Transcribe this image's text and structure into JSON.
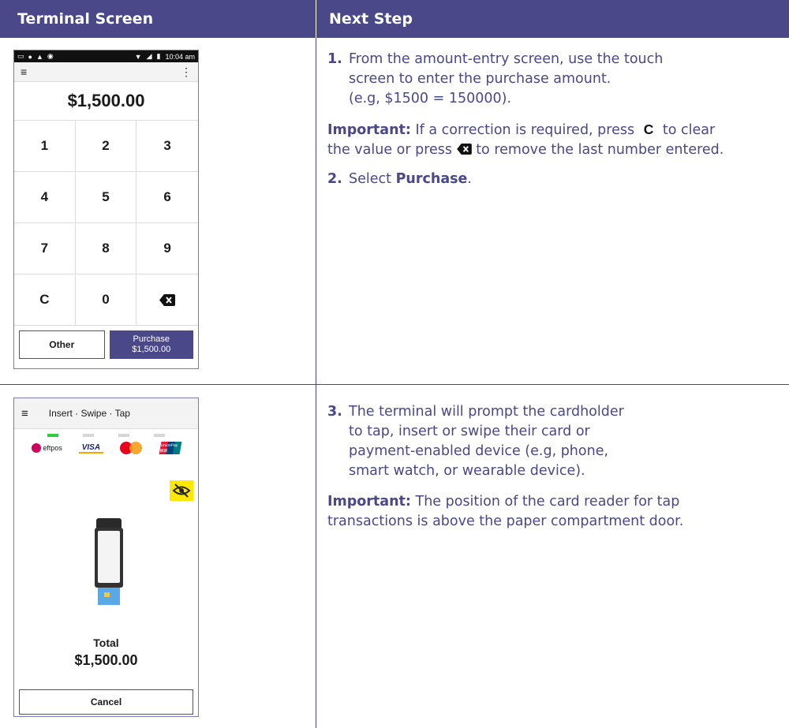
{
  "headers": {
    "left": "Terminal Screen",
    "right": "Next Step"
  },
  "screen1": {
    "status_time": "10:04 am",
    "amount": "$1,500.00",
    "keys": [
      "1",
      "2",
      "3",
      "4",
      "5",
      "6",
      "7",
      "8",
      "9",
      "C",
      "0"
    ],
    "other_label": "Other",
    "purchase_label": "Purchase",
    "purchase_amount": "$1,500.00"
  },
  "screen2": {
    "title": "Insert · Swipe · Tap",
    "eftpos": "eftpos",
    "visa": "VISA",
    "unionpay": "UnionPay 银联",
    "total_label": "Total",
    "total_amount": "$1,500.00",
    "cancel_label": "Cancel"
  },
  "steps": {
    "s1_num": "1.",
    "s1_line1": "From the amount-entry screen, use the touch",
    "s1_line2": "screen to enter the purchase amount.",
    "s1_line3": "(e.g, $1500 = 150000).",
    "imp1_label": "Important:",
    "imp1_a": "If a correction is required, press",
    "imp1_c": "C",
    "imp1_b": "to clear",
    "imp1_c2": "the value or press",
    "imp1_d": "to remove the last number entered.",
    "s2_num": "2.",
    "s2_pre": "Select",
    "s2_bold": "Purchase",
    "s2_post": ".",
    "s3_num": "3.",
    "s3_line1": "The terminal will prompt the cardholder",
    "s3_line2": "to tap, insert or swipe their card or",
    "s3_line3": "payment-enabled device (e.g, phone,",
    "s3_line4": "smart watch, or wearable device).",
    "imp2_label": "Important:",
    "imp2_line1": "The position of the card reader for tap",
    "imp2_line2": "transactions is above the paper compartment door."
  },
  "colors": {
    "header_bg": "#4a4888",
    "accent": "#4a4888",
    "indicator_on": "#2ecc40",
    "eye_bg": "#ffe800"
  },
  "icons": [
    "menu-icon",
    "more-vert-icon",
    "backspace-icon",
    "eye-off-icon",
    "wifi-icon",
    "battery-icon"
  ]
}
